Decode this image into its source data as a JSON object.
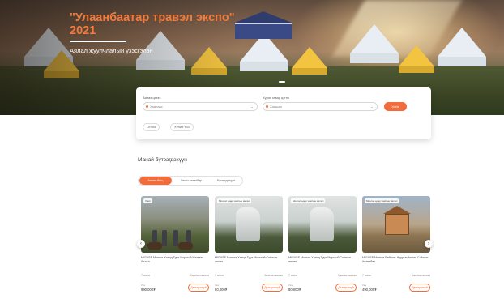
{
  "hero": {
    "title": "\"Улаанбаатар травэл экспо\"",
    "year": "2021",
    "subtitle": "Аялал жуулчлалын үзэсгэлэн"
  },
  "search": {
    "from_label": "Аялах цэгээ",
    "from_placeholder": "Хаанаас",
    "to_label": "Хүрэх газар цэгээ",
    "to_placeholder": "Хаашаа",
    "button_label": "Хайх",
    "chips": [
      "Огноо",
      "Хүний тоо"
    ]
  },
  "section": {
    "title": "Манай бүтээгдэхүүн",
    "tabs": [
      "Аялал багц",
      "Хөтөч хөтөлбөр",
      "Бүтээгдэхүүн"
    ]
  },
  "cards": [
    {
      "badge": "Хэмт",
      "name": "MIGASE Монгол Хаанд Туул Морьтой Малчин Аялал",
      "duration": "7 хоног",
      "tag": "Хамтын аялал",
      "price_label": "Үнэ",
      "price": "990,000₮",
      "book_label": "Дэлгэрэнгүй"
    },
    {
      "badge": "Монгол өдөр хамтын аялал",
      "name": "MIGASE Монгол Хаанд Туул Морьтой Соёлын аялал",
      "duration": "7 хоног",
      "tag": "Хамтын аялал",
      "price_label": "Үнэ",
      "price": "80,000₮",
      "book_label": "Дэлгэрэнгүй"
    },
    {
      "badge": "Монгол өдөр хамтын аялал",
      "name": "MIGASE Монгол Хаанд Туул Морьтой Соёлын аялал",
      "duration": "7 хоног",
      "tag": "Хамтын аялал",
      "price_label": "Үнэ",
      "price": "80,000₮",
      "book_label": "Дэлгэрэнгүй"
    },
    {
      "badge": "Монгол өдөр хамтын аялал",
      "name": "MIGASE Монгол Байгаль Нуурын Аялал Соёлын Хөтөлбөр",
      "duration": "7 хоног",
      "tag": "Хамтын аялал",
      "price_label": "Үнэ",
      "price": "490,000₮",
      "book_label": "Дэлгэрэнгүй"
    }
  ],
  "icons": {
    "prev": "chevron-left-icon",
    "next": "chevron-right-icon",
    "location": "location-pin-icon"
  },
  "colors": {
    "accent": "#f26b3a",
    "title": "#f37a3a"
  }
}
